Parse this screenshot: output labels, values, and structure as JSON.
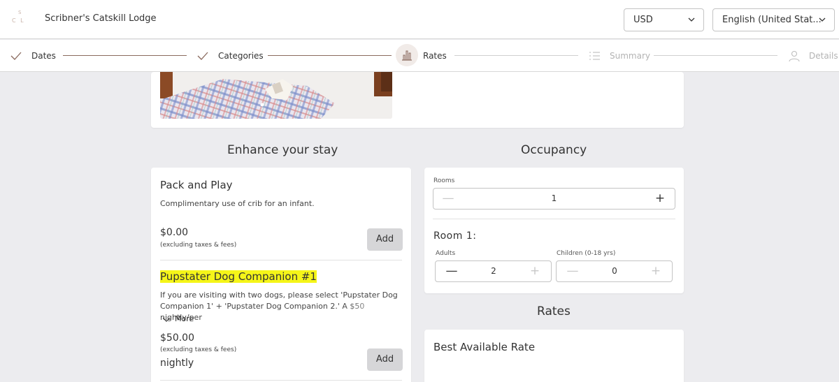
{
  "header": {
    "logo_text_top": "S",
    "logo_text_bottom": "C L",
    "hotel_name": "Scribner's Catskill Lodge",
    "currency": "USD",
    "language": "English (United Stat..."
  },
  "steps": [
    {
      "label": "Dates",
      "state": "done"
    },
    {
      "label": "Categories",
      "state": "done"
    },
    {
      "label": "Rates",
      "state": "current"
    },
    {
      "label": "Summary",
      "state": "upcoming"
    },
    {
      "label": "Details",
      "state": "upcoming"
    }
  ],
  "enhance": {
    "title": "Enhance your stay",
    "items": [
      {
        "title": "Pack and Play",
        "description": "Complimentary use of crib for an infant.",
        "price": "$0.00",
        "price_note": "(excluding taxes & fees)",
        "add_label": "Add"
      },
      {
        "title": "Pupstater Dog Companion #1",
        "description": "If you are visiting with two dogs, please select 'Pupstater Dog Companion 1' + 'Pupstater Dog Companion 2.' A $50 nightly/per",
        "more_label": "More",
        "price": "$50.00",
        "price_note": "(excluding taxes & fees)",
        "price_unit": "nightly",
        "add_label": "Add"
      }
    ]
  },
  "occupancy": {
    "title": "Occupancy",
    "rooms_label": "Rooms",
    "rooms_value": "1",
    "room_title": "Room 1:",
    "adults_label": "Adults",
    "adults_value": "2",
    "children_label": "Children (0-18 yrs)",
    "children_value": "0"
  },
  "rates": {
    "title": "Rates",
    "best_rate_title": "Best Available Rate"
  },
  "colors": {
    "accent": "#8a6a5e",
    "highlight": "#f5f519",
    "button_bg": "#d6d6d8"
  }
}
